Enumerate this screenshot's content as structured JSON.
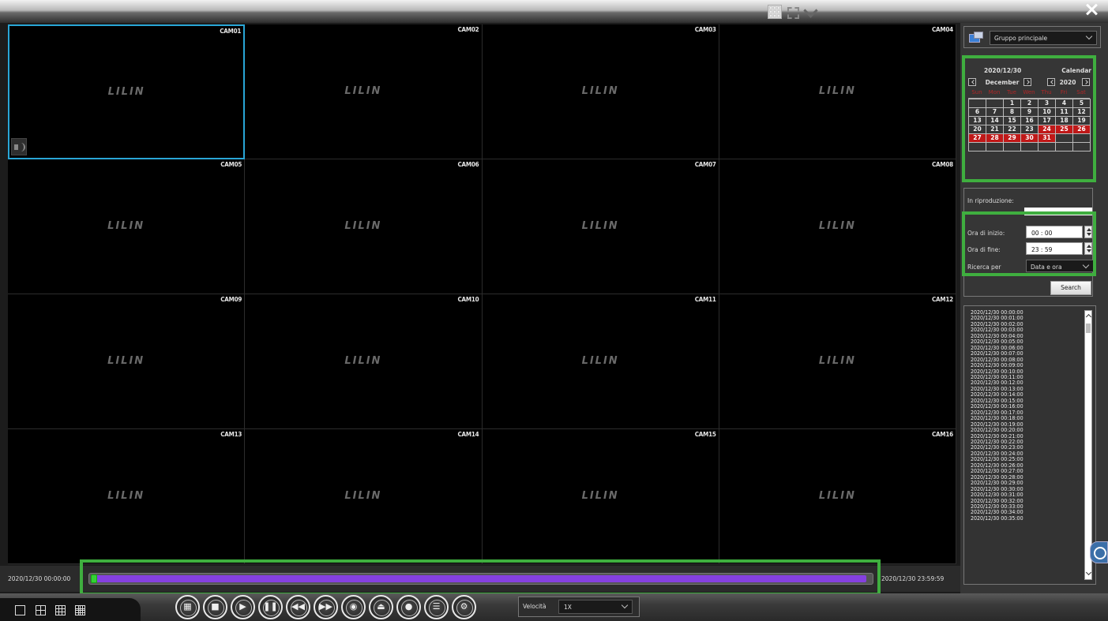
{
  "header": {},
  "cameras": [
    {
      "label": "CAM01",
      "logo": "LILIN"
    },
    {
      "label": "CAM02",
      "logo": "LILIN"
    },
    {
      "label": "CAM03",
      "logo": "LILIN"
    },
    {
      "label": "CAM04",
      "logo": "LILIN"
    },
    {
      "label": "CAM05",
      "logo": "LILIN"
    },
    {
      "label": "CAM06",
      "logo": "LILIN"
    },
    {
      "label": "CAM07",
      "logo": "LILIN"
    },
    {
      "label": "CAM08",
      "logo": "LILIN"
    },
    {
      "label": "CAM09",
      "logo": "LILIN"
    },
    {
      "label": "CAM10",
      "logo": "LILIN"
    },
    {
      "label": "CAM11",
      "logo": "LILIN"
    },
    {
      "label": "CAM12",
      "logo": "LILIN"
    },
    {
      "label": "CAM13",
      "logo": "LILIN"
    },
    {
      "label": "CAM14",
      "logo": "LILIN"
    },
    {
      "label": "CAM15",
      "logo": "LILIN"
    },
    {
      "label": "CAM16",
      "logo": "LILIN"
    }
  ],
  "timeline": {
    "start": "2020/12/30 00:00:00",
    "end": "2020/12/30 23:59:59",
    "fill_fraction": 0.995,
    "position_fraction": 0.0
  },
  "speed": {
    "label": "Velocità",
    "value": "1X"
  },
  "group": {
    "selected": "Gruppo principale"
  },
  "calendar": {
    "selected_date": "2020/12/30",
    "title": "Calendar",
    "month": "December",
    "year": "2020",
    "weekdays": [
      "Sun",
      "Mon",
      "Tue",
      "Wen",
      "Thu",
      "Fri",
      "Sat"
    ],
    "days": [
      "",
      "",
      "1",
      "2",
      "3",
      "4",
      "5",
      "6",
      "7",
      "8",
      "9",
      "10",
      "11",
      "12",
      "13",
      "14",
      "15",
      "16",
      "17",
      "18",
      "19",
      "20",
      "21",
      "22",
      "23",
      "24",
      "25",
      "26",
      "27",
      "28",
      "29",
      "30",
      "31",
      "",
      "",
      "",
      "",
      "",
      "",
      "",
      "",
      ""
    ],
    "recorded_days": [
      "24",
      "25",
      "26",
      "27",
      "28",
      "29",
      "30",
      "31"
    ]
  },
  "playback": {
    "title": "In riproduzione:",
    "start_label": "Ora di inizio:",
    "start_value": "00 : 00",
    "end_label": "Ora di fine:",
    "end_value": "23 : 59",
    "search_by_label": "Ricerca per",
    "search_by_value": "Data e ora",
    "search_button": "Search"
  },
  "results": [
    "2020/12/30 00:00:00",
    "2020/12/30 00:01:00",
    "2020/12/30 00:02:00",
    "2020/12/30 00:03:00",
    "2020/12/30 00:04:00",
    "2020/12/30 00:05:00",
    "2020/12/30 00:06:00",
    "2020/12/30 00:07:00",
    "2020/12/30 00:08:00",
    "2020/12/30 00:09:00",
    "2020/12/30 00:10:00",
    "2020/12/30 00:11:00",
    "2020/12/30 00:12:00",
    "2020/12/30 00:13:00",
    "2020/12/30 00:14:00",
    "2020/12/30 00:15:00",
    "2020/12/30 00:16:00",
    "2020/12/30 00:17:00",
    "2020/12/30 00:18:00",
    "2020/12/30 00:19:00",
    "2020/12/30 00:20:00",
    "2020/12/30 00:21:00",
    "2020/12/30 00:22:00",
    "2020/12/30 00:23:00",
    "2020/12/30 00:24:00",
    "2020/12/30 00:25:00",
    "2020/12/30 00:26:00",
    "2020/12/30 00:27:00",
    "2020/12/30 00:28:00",
    "2020/12/30 00:29:00",
    "2020/12/30 00:30:00",
    "2020/12/30 00:31:00",
    "2020/12/30 00:32:00",
    "2020/12/30 00:33:00",
    "2020/12/30 00:34:00",
    "2020/12/30 00:35:00"
  ],
  "controls": [
    {
      "name": "grid-layout-button",
      "icon": "grid-icon",
      "glyph": "▦"
    },
    {
      "name": "stop-button",
      "icon": "stop-icon",
      "glyph": "■"
    },
    {
      "name": "play-button",
      "icon": "play-icon",
      "glyph": "▶"
    },
    {
      "name": "pause-button",
      "icon": "pause-icon",
      "glyph": "❚❚"
    },
    {
      "name": "rewind-button",
      "icon": "rewind-icon",
      "glyph": "◀◀"
    },
    {
      "name": "fast-forward-button",
      "icon": "fast-forward-icon",
      "glyph": "▶▶"
    },
    {
      "name": "snapshot-button",
      "icon": "camera-lens-icon",
      "glyph": "◉"
    },
    {
      "name": "export-button",
      "icon": "export-icon",
      "glyph": "⏏"
    },
    {
      "name": "record-button",
      "icon": "record-icon",
      "glyph": "●"
    },
    {
      "name": "list-button",
      "icon": "list-icon",
      "glyph": "☰"
    },
    {
      "name": "settings-button",
      "icon": "settings-list-icon",
      "glyph": "⚙"
    }
  ],
  "layouts": [
    {
      "name": "layout-1-button",
      "icon": "single-view-icon"
    },
    {
      "name": "layout-4-button",
      "icon": "quad-view-icon"
    },
    {
      "name": "layout-9-button",
      "icon": "nine-view-icon"
    },
    {
      "name": "layout-16-button",
      "icon": "sixteen-view-icon"
    }
  ],
  "colors": {
    "accent_selection": "#29a6d6",
    "timeline_fill": "#8540e0",
    "highlight": "#3fae3f",
    "recorded_day": "#c01818"
  }
}
